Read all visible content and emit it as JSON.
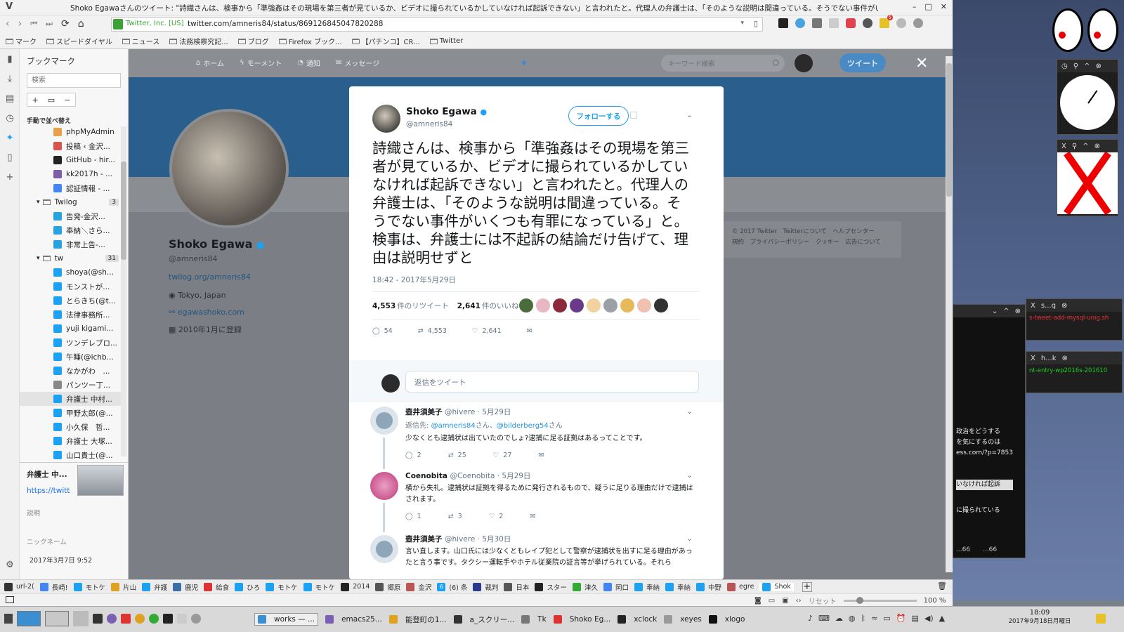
{
  "window": {
    "title": "Shoko Egawaさんのツイート: \"詩織さんは、検事から「準強姦はその現場を第三者が見ているか、ビデオに撮られているかしていなければ起訴できない」と言われたと。代理人の弁護士は、「そのような説明は間違っている。そうでない事件がいくつも有罪にな...",
    "v_icon": "V"
  },
  "urlbar": {
    "identity": "Twitter, Inc. [US]",
    "url": "twitter.com/amneris84/status/869126845047820288",
    "badge_count": "5"
  },
  "bookmarks_bar": [
    "マーク",
    "スピードダイヤル",
    "ニュース",
    "法務検察究記...",
    "ブログ",
    "Firefox ブック...",
    "【パチンコ】CR...",
    "Twitter"
  ],
  "sidebar": {
    "title": "ブックマーク",
    "search_placeholder": "検索",
    "tool_add": "+",
    "tool_folder": "▭",
    "tool_remove": "−",
    "sort_label": "手動で並べ替え",
    "items": [
      {
        "label": "phpMyAdmin",
        "color": "#e8a04a",
        "indent": 1
      },
      {
        "label": "投稿 ‹ 金沢...",
        "color": "#d9534f",
        "indent": 1
      },
      {
        "label": "GitHub - hir...",
        "color": "#222222",
        "indent": 1
      },
      {
        "label": "kk2017h - ...",
        "color": "#7b5ea7",
        "indent": 1
      },
      {
        "label": "認証情報 - ...",
        "color": "#4285f4",
        "indent": 1
      },
      {
        "label": "Twilog",
        "color": "folder",
        "indent": 0,
        "count": "3"
      },
      {
        "label": "告発-金沢...",
        "color": "#29a3e0",
        "indent": 1
      },
      {
        "label": "奉納＼さら...",
        "color": "#29a3e0",
        "indent": 1
      },
      {
        "label": "非常上告-...",
        "color": "#29a3e0",
        "indent": 1
      },
      {
        "label": "tw",
        "color": "folder",
        "indent": 0,
        "count": "31"
      },
      {
        "label": "shoya(@sh...",
        "color": "#1da1f2",
        "indent": 1
      },
      {
        "label": "モンストが...",
        "color": "#1da1f2",
        "indent": 1
      },
      {
        "label": "とらきち(@t...",
        "color": "#1da1f2",
        "indent": 1
      },
      {
        "label": "法律事務所...",
        "color": "#1da1f2",
        "indent": 1
      },
      {
        "label": "yuji kigami...",
        "color": "#1da1f2",
        "indent": 1
      },
      {
        "label": "ツンデレブロ...",
        "color": "#1da1f2",
        "indent": 1
      },
      {
        "label": "午睡(@ichb...",
        "color": "#1da1f2",
        "indent": 1
      },
      {
        "label": "なかがわ　...",
        "color": "#1da1f2",
        "indent": 1
      },
      {
        "label": "パンツー丁...",
        "color": "#888888",
        "indent": 1
      },
      {
        "label": "弁護士 中村...",
        "color": "#1da1f2",
        "indent": 1,
        "selected": true
      },
      {
        "label": "甲野太郎(@...",
        "color": "#1da1f2",
        "indent": 1
      },
      {
        "label": "小久保　哲...",
        "color": "#1da1f2",
        "indent": 1
      },
      {
        "label": "弁護士 大塚...",
        "color": "#1da1f2",
        "indent": 1
      },
      {
        "label": "山口貴士(@...",
        "color": "#1da1f2",
        "indent": 1
      }
    ],
    "detail": {
      "name": "弁護士 中...",
      "url": "https://twitt",
      "desc_label": "説明",
      "nick_label": "ニックネーム",
      "date": "2017年3月7日 9:52"
    }
  },
  "twitter_nav": {
    "home": "ホーム",
    "moments": "モーメント",
    "notifications": "通知",
    "messages": "メッセージ",
    "search_placeholder": "キーワード検索",
    "tweet_button": "ツイート"
  },
  "profile": {
    "name": "Shoko Egawa",
    "handle": "@amneris84",
    "link": "twilog.org/amneris84",
    "location": "Tokyo, Japan",
    "website": "egawashoko.com",
    "joined": "2010年1月に登録"
  },
  "footer": {
    "line1": "© 2017 Twitter　Twitterについて　ヘルプセンター",
    "line2": "規約　プライバシーポリシー　クッキー　広告について"
  },
  "tweet": {
    "author": "Shoko Egawa",
    "handle": "@amneris84",
    "follow_label": "フォローする",
    "text": "詩織さんは、検事から「準強姦はその現場を第三者が見ているか、ビデオに撮られているかしていなければ起訴できない」と言われたと。代理人の弁護士は、「そのような説明は間違っている。そうでない事件がいくつも有罪になっている」と。検事は、弁護士には不起訴の結論だけ告げて、理由は説明せずと",
    "timestamp": "18:42 - 2017年5月29日",
    "retweets": "4,553",
    "retweets_label": "件のリツイート",
    "likes": "2,641",
    "likes_label": "件のいいね",
    "reply_count": "54",
    "rt_count": "4,553",
    "like_count": "2,641",
    "liker_colors": [
      "#4a6b3a",
      "#e9b7c4",
      "#8a2a3a",
      "#6a3a8a",
      "#f2d2a0",
      "#9aa0a6",
      "#e6b95a",
      "#f0c0b0",
      "#333333"
    ]
  },
  "reply_placeholder": "返信をツイート",
  "replies": [
    {
      "name": "壺井須美子",
      "meta": "@hivere · 5月29日",
      "reply_to_label": "返信先:",
      "mention1": "@amneris84",
      "mention_suffix1": "さん、",
      "mention2": "@bilderberg54",
      "mention_suffix2": "さん",
      "text": "少なくとも逮捕状は出ていたのでしょ?逮捕に足る証拠はあるってことです。",
      "reply": "2",
      "rt": "25",
      "like": "27"
    },
    {
      "name": "Coenobita",
      "meta": "@Coenobita · 5月29日",
      "text": "横から失礼。逮捕状は証拠を得るために発行されるもので、疑うに足りる理由だけで逮捕はされます。",
      "reply": "1",
      "rt": "3",
      "like": "2"
    },
    {
      "name": "壺井須美子",
      "meta": "@hivere · 5月30日",
      "text": "言い直します。山口氏には少なくともレイプ犯として警察が逮捕状を出すに足る理由があったと言う事です。タクシー運転手やホテル従業院の証言等が挙げられている。それら"
    }
  ],
  "desktop": {
    "terminal_lines": [
      "政治をどうする",
      "を気にするのは",
      "ess.com/?p=7853",
      "いなければ起訴",
      "に撮られている"
    ],
    "term_status_left": "...66",
    "term_status_right": "...66",
    "win1_title": "s...q",
    "win1_text": "s-tweet-add-mysql-unig.sh",
    "win2_title": "h...k",
    "win2_text": "nt-entry-wp2016s-201610"
  },
  "tabs": [
    "url-2(",
    "長崎!",
    "モトケ",
    "片山",
    "弁護",
    "鹿児",
    "給食",
    "ひろ",
    "モトケ",
    "モトケ",
    "2014",
    "郷原",
    "金沢",
    "(6) 条",
    "裁判",
    "日本",
    "スター",
    "津久",
    "岡口",
    "奉納",
    "奉納",
    "中野",
    "egre",
    "Shok"
  ],
  "tab_badge": "6",
  "statusbar": {
    "reset": "リセット",
    "zoom": "100 %"
  },
  "taskbar": {
    "items": [
      "works — ...",
      "emacs25...",
      "能登町の1...",
      "a_スクリー...",
      "Tk",
      "Shoko Eg...",
      "xclock",
      "xeyes",
      "xlogo"
    ],
    "clock_time": "18:09",
    "clock_date": "2017年9月18日月曜日"
  }
}
